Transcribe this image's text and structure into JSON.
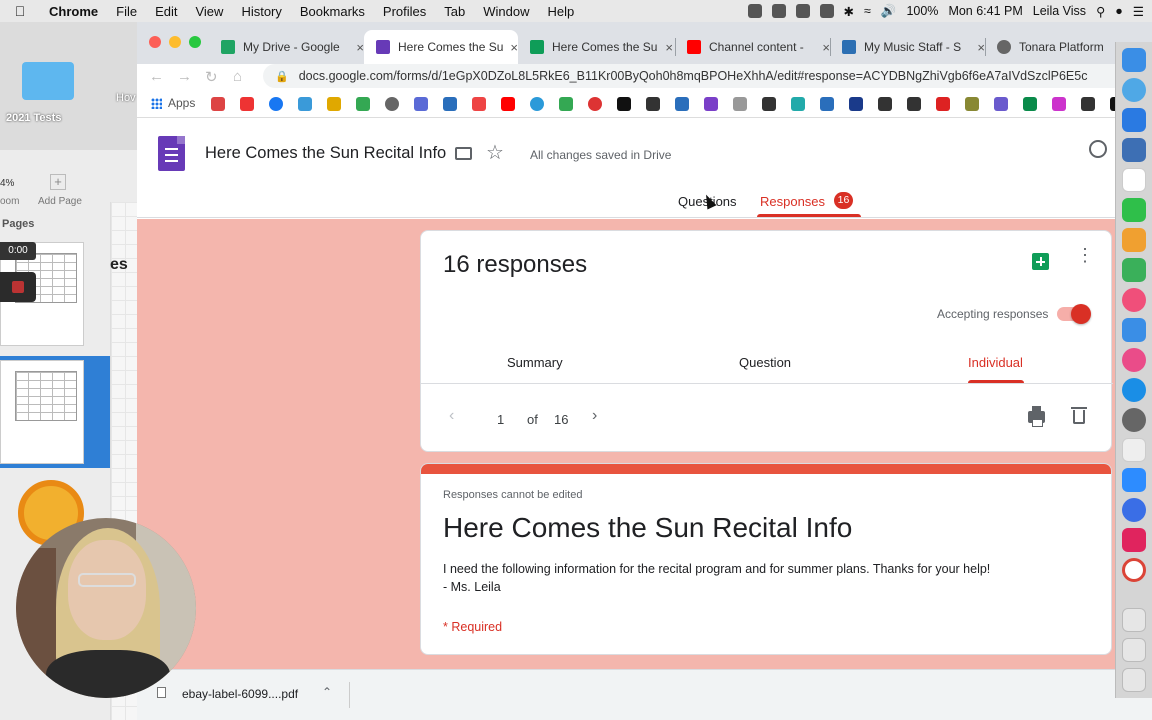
{
  "menubar": {
    "app": "Chrome",
    "items": [
      "File",
      "Edit",
      "View",
      "History",
      "Bookmarks",
      "Profiles",
      "Tab",
      "Window",
      "Help"
    ],
    "battery": "100%",
    "clock": "Mon 6:41 PM",
    "user": "Leila Viss"
  },
  "desktop": {
    "folder_label": "2021 Tests",
    "hover_label": "Hov",
    "zoom": "4%",
    "zoom_label": "oom",
    "add_page": "Add Page",
    "pages_label": "Pages",
    "timer": "0:00",
    "side_text": "es"
  },
  "browser": {
    "tabs": [
      {
        "title": "My Drive - Google",
        "close": "×",
        "color": "#1fa463"
      },
      {
        "title": "Here Comes the Su",
        "close": "×",
        "color": "#673ab7",
        "active": true
      },
      {
        "title": "Here Comes the Su",
        "close": "×",
        "color": "#0f9d58"
      },
      {
        "title": "Channel content -",
        "close": "×",
        "color": "#ff0000"
      },
      {
        "title": "My Music Staff - S",
        "close": "×",
        "color": "#2c6fb3"
      },
      {
        "title": "Tonara Platform",
        "close": "",
        "color": "#666666"
      }
    ],
    "url": "docs.google.com/forms/d/1eGpX0DZoL8L5RkE6_B11Kr00ByQoh0h8mqBPOHeXhhA/edit#response=ACYDBNgZhiVgb6f6eA7aIVdSzclP6E5c",
    "bookmarks_apps": "Apps"
  },
  "form_header": {
    "title": "Here Comes the Sun Recital Info",
    "saved_status": "All changes saved in Drive",
    "tab_questions": "Questions",
    "tab_responses": "Responses",
    "responses_badge": "16"
  },
  "responses_card": {
    "count_label": "16 responses",
    "accepting_label": "Accepting responses",
    "accepting": true,
    "tab_summary": "Summary",
    "tab_question": "Question",
    "tab_individual": "Individual",
    "current_page": "1",
    "of_label": "of",
    "total_pages": "16"
  },
  "form_card": {
    "notice": "Responses cannot be edited",
    "title": "Here Comes the Sun Recital Info",
    "description_line1": "I need the following information for the recital program and for summer plans. Thanks for your help!",
    "description_line2": "- Ms. Leila",
    "required_label": "* Required"
  },
  "download_bar": {
    "filename": "ebay-label-6099....pdf"
  },
  "colors": {
    "accent": "#d93025",
    "theme_bg": "#f4b6ad",
    "forms_purple": "#673ab7"
  }
}
